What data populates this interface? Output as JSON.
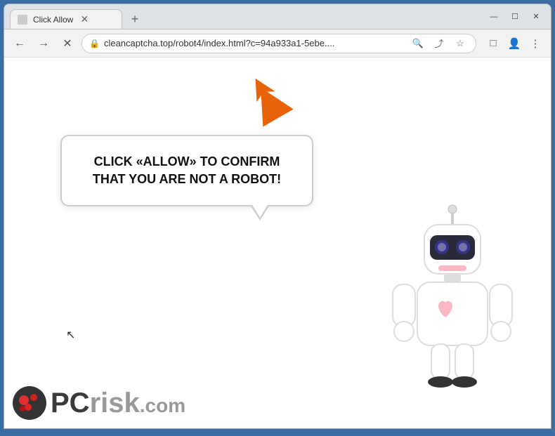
{
  "browser": {
    "tab_title": "Click Allow",
    "url": "cleancaptcha.top/robot4/index.html?c=94a933a1-5ebe....",
    "new_tab_icon": "+",
    "window_controls": {
      "minimize": "—",
      "maximize": "☐",
      "close": "✕"
    },
    "nav": {
      "back": "←",
      "forward": "→",
      "reload": "✕"
    },
    "toolbar_icons": {
      "search": "🔍",
      "share": "⤴",
      "star": "☆",
      "extensions": "□",
      "profile": "👤",
      "menu": "⋮"
    }
  },
  "page": {
    "bubble_text": "CLICK «ALLOW» TO CONFIRM THAT YOU ARE NOT A ROBOT!",
    "arrow_color": "#E8620A"
  },
  "logo": {
    "pc": "PC",
    "risk": "risk",
    "domain": ".com"
  }
}
